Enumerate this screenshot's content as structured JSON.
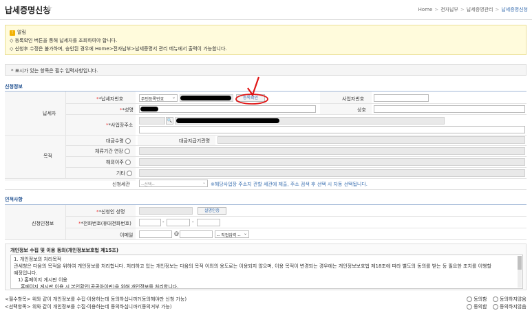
{
  "header": {
    "title": "납세증명신청",
    "breadcrumb": [
      "Home",
      "전자납부",
      "납세증명관리",
      "납세증명신청"
    ]
  },
  "notice": {
    "title": "알림",
    "lines": [
      "◇ 등록확인 버튼을 통해 납세자를 조회하여야 합니다.",
      "◇ 신청후 수정은 불가하며, 승인된 경우에 Home>전자납부>납세증명서 관리 메뉴에서 출력이 가능합니다."
    ]
  },
  "required_note": "* 표시가 있는 항목은 필수 입력사항입니다.",
  "applicant": {
    "section_title": "신청정보",
    "taxpayer_group": "납세자",
    "taxpayer_no_label": "*납세자번호",
    "id_type_value": "주민등록번호",
    "register_check_btn": "등록확인",
    "biz_no_label": "사업자번호",
    "name_label": "*성명",
    "company_label": "상호",
    "address_label": "*사업장주소",
    "purpose_group": "목적",
    "purposes": [
      "대금수령",
      "체류기간 연장",
      "해외이주",
      "기타"
    ],
    "payer_agency_label": "대금지급기관명",
    "office_label": "신청세관",
    "office_placeholder": "--선택--",
    "office_note": "※해당사업장 주소지 관할 세관에 제출, 주소 검색 후 선택 시 자동 선택됩니다."
  },
  "person": {
    "section_title": "인적사항",
    "group_label": "신청인정보",
    "applicant_name_label": "*신청인 성명",
    "auth_btn": "실명인증",
    "phone_label": "*전화번호(휴대전화번호)",
    "phone_dash": "-",
    "email_label": "이메일",
    "email_at": "@",
    "email_select": "-- 직접입력 --"
  },
  "privacy": {
    "title": "개인정보 수집 및 이용 동의(개인정보보호법 제15조)",
    "lines": [
      "1. 개인정보의 처리목적",
      "관세청은 다음의 목적을 위하여 개인정보를 처리합니다. 처리하고 있는 개인정보는 다음의 목적 이외의 용도로는 이용되지 않으며, 이용 목적이 변경되는 경우에는 개인정보보호법 제18조에 따라 별도의 동의를 받는 등 필요한 조치를 이행할",
      "예정입니다.",
      "  1) 홈페이지 게시판 이용",
      "    홈페이지 게시판 이용 시 본인확인(공공아이핀)을 위해 개인정보를 처리합니다."
    ]
  },
  "consents": [
    {
      "text": "<필수항목> 위와 같이 개인정보를 수집·이용하는데 동의하십니까?(동의해야만 신청 가능)",
      "agree": "동의함",
      "disagree": "동의하지않음"
    },
    {
      "text": "<선택항목> 위와 같이 개인정보를 수집·이용하는데 동의하십니까?(동의거부 가능)",
      "agree": "동의함",
      "disagree": "동의하지않음"
    }
  ],
  "colors": {
    "section": "#1d4e8f",
    "required": "#e33333",
    "annotation": "#e01515",
    "notice_bg": "#fffbdc"
  }
}
